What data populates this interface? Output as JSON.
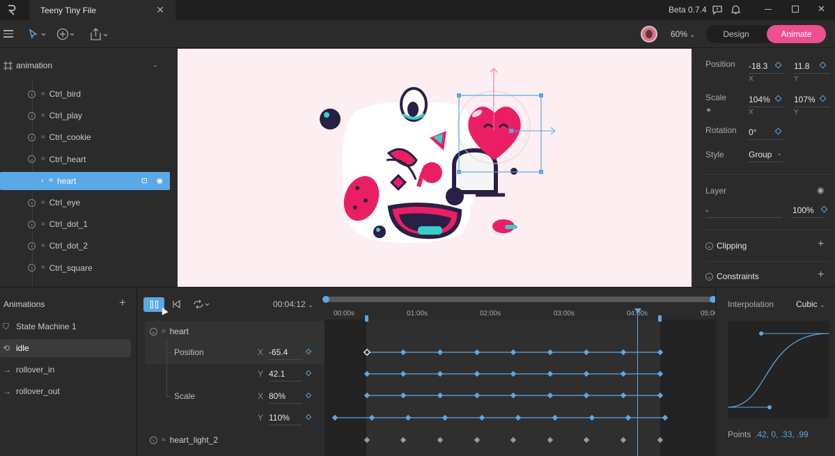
{
  "app": {
    "tab_title": "Teeny Tiny File",
    "version": "Beta 0.7.4",
    "zoom": "60%",
    "mode_design": "Design",
    "mode_animate": "Animate"
  },
  "tree": {
    "root": "animation",
    "items": [
      {
        "label": "Ctrl_bird",
        "level": 1,
        "expanded": false,
        "selected": false
      },
      {
        "label": "Ctrl_play",
        "level": 1,
        "expanded": false,
        "selected": false
      },
      {
        "label": "Ctrl_cookie",
        "level": 1,
        "expanded": false,
        "selected": false
      },
      {
        "label": "Ctrl_heart",
        "level": 1,
        "expanded": true,
        "selected": false
      },
      {
        "label": "heart",
        "level": 2,
        "expanded": false,
        "selected": true
      },
      {
        "label": "Ctrl_eye",
        "level": 1,
        "expanded": false,
        "selected": false
      },
      {
        "label": "Ctrl_dot_1",
        "level": 1,
        "expanded": false,
        "selected": false
      },
      {
        "label": "Ctrl_dot_2",
        "level": 1,
        "expanded": false,
        "selected": false
      },
      {
        "label": "Ctrl_square",
        "level": 1,
        "expanded": false,
        "selected": false
      }
    ]
  },
  "inspector": {
    "position_label": "Position",
    "pos_x": "-18.3",
    "pos_y": "11.8",
    "x_label": "X",
    "y_label": "Y",
    "scale_label": "Scale",
    "scale_x": "104%",
    "scale_y": "107%",
    "rotation_label": "Rotation",
    "rotation": "0°",
    "style_label": "Style",
    "style": "Group",
    "layer_label": "Layer",
    "layer_blend": "-",
    "layer_opacity": "100%",
    "clipping": "Clipping",
    "constraints": "Constraints"
  },
  "animations": {
    "header": "Animations",
    "items": [
      {
        "label": "State Machine 1",
        "icon": "state-machine-icon"
      },
      {
        "label": "idle",
        "icon": "loop-icon",
        "selected": true
      },
      {
        "label": "rollover_in",
        "icon": "arrow-right-icon"
      },
      {
        "label": "rollover_out",
        "icon": "arrow-right-icon"
      }
    ]
  },
  "timeline": {
    "time": "00:04:12",
    "ruler": [
      "00:00s",
      "01:00s",
      "02:00s",
      "03:00s",
      "04:00s",
      "05:00"
    ],
    "group": "heart",
    "rows": [
      {
        "prop": "Position",
        "axis": "X",
        "value": "-65.4"
      },
      {
        "prop": "",
        "axis": "Y",
        "value": "42.1"
      },
      {
        "prop": "Scale",
        "axis": "X",
        "value": "80%"
      },
      {
        "prop": "",
        "axis": "Y",
        "value": "110%"
      }
    ],
    "next_group": "heart_light_2"
  },
  "interpolation": {
    "label": "Interpolation",
    "type": "Cubic",
    "points_label": "Points",
    "points": ".42, 0, .33, .99"
  },
  "colors": {
    "accent": "#5aa8e6",
    "animate": "#ee4f8f",
    "pink": "#ea1f63",
    "navy": "#2a1f45",
    "teal": "#35d0cc",
    "canvas": "#fdeef1"
  }
}
